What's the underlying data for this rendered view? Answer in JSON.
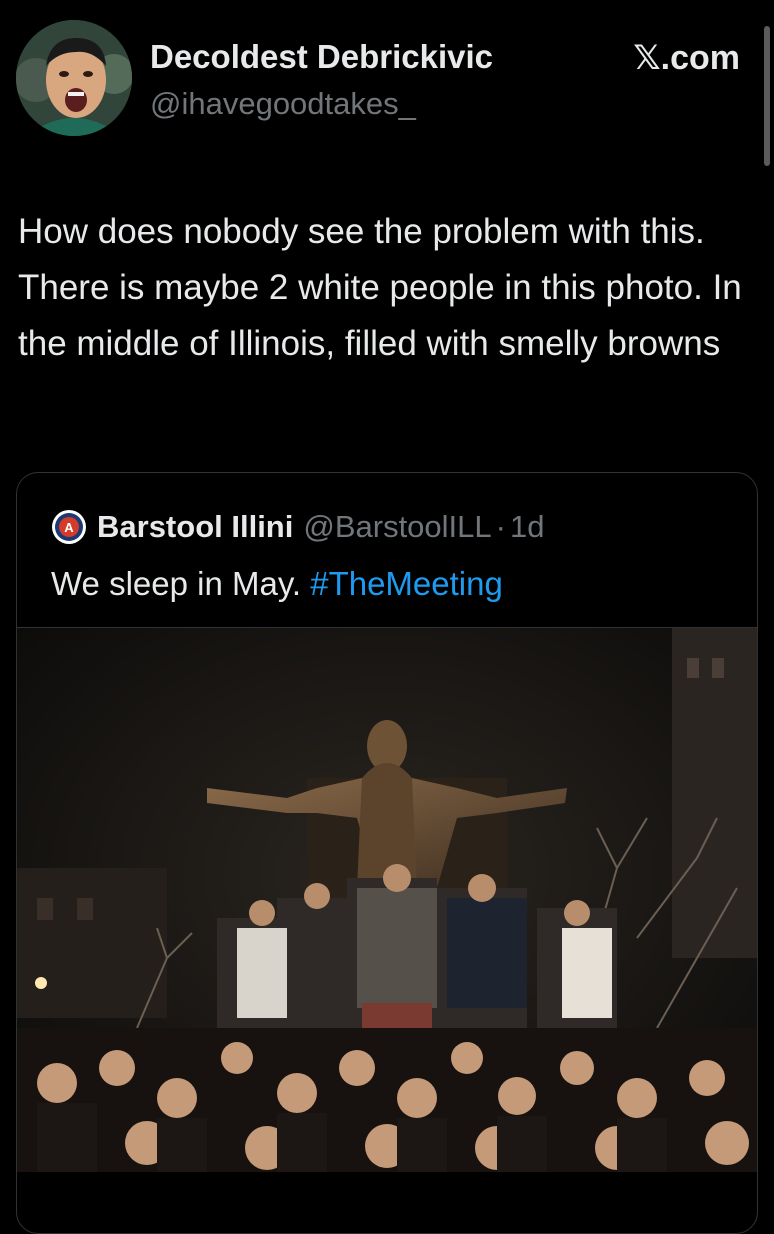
{
  "author": {
    "display_name": "Decoldest Debrickivic",
    "handle": "@ihavegoodtakes_",
    "avatar_icon": "avatar-photo"
  },
  "brand": "𝕏.com",
  "tweet": {
    "text": "How does nobody see the problem with this. There is maybe 2 white people in this photo. In the middle of Illinois, filled with smelly browns"
  },
  "quoted_tweet": {
    "logo_icon": "barstool-logo-icon",
    "logo_letter": "A",
    "name": "Barstool Illini",
    "handle": "@BarstoolILL",
    "separator": "·",
    "time": "1d",
    "text_plain": "We sleep in May.",
    "hashtag": "#TheMeeting",
    "photo_icon": "statue-crowd-photo"
  },
  "colors": {
    "background": "#000000",
    "text": "#e7e9ea",
    "secondary_text": "#71767b",
    "link": "#1d9bf0",
    "border": "#2f3336"
  }
}
